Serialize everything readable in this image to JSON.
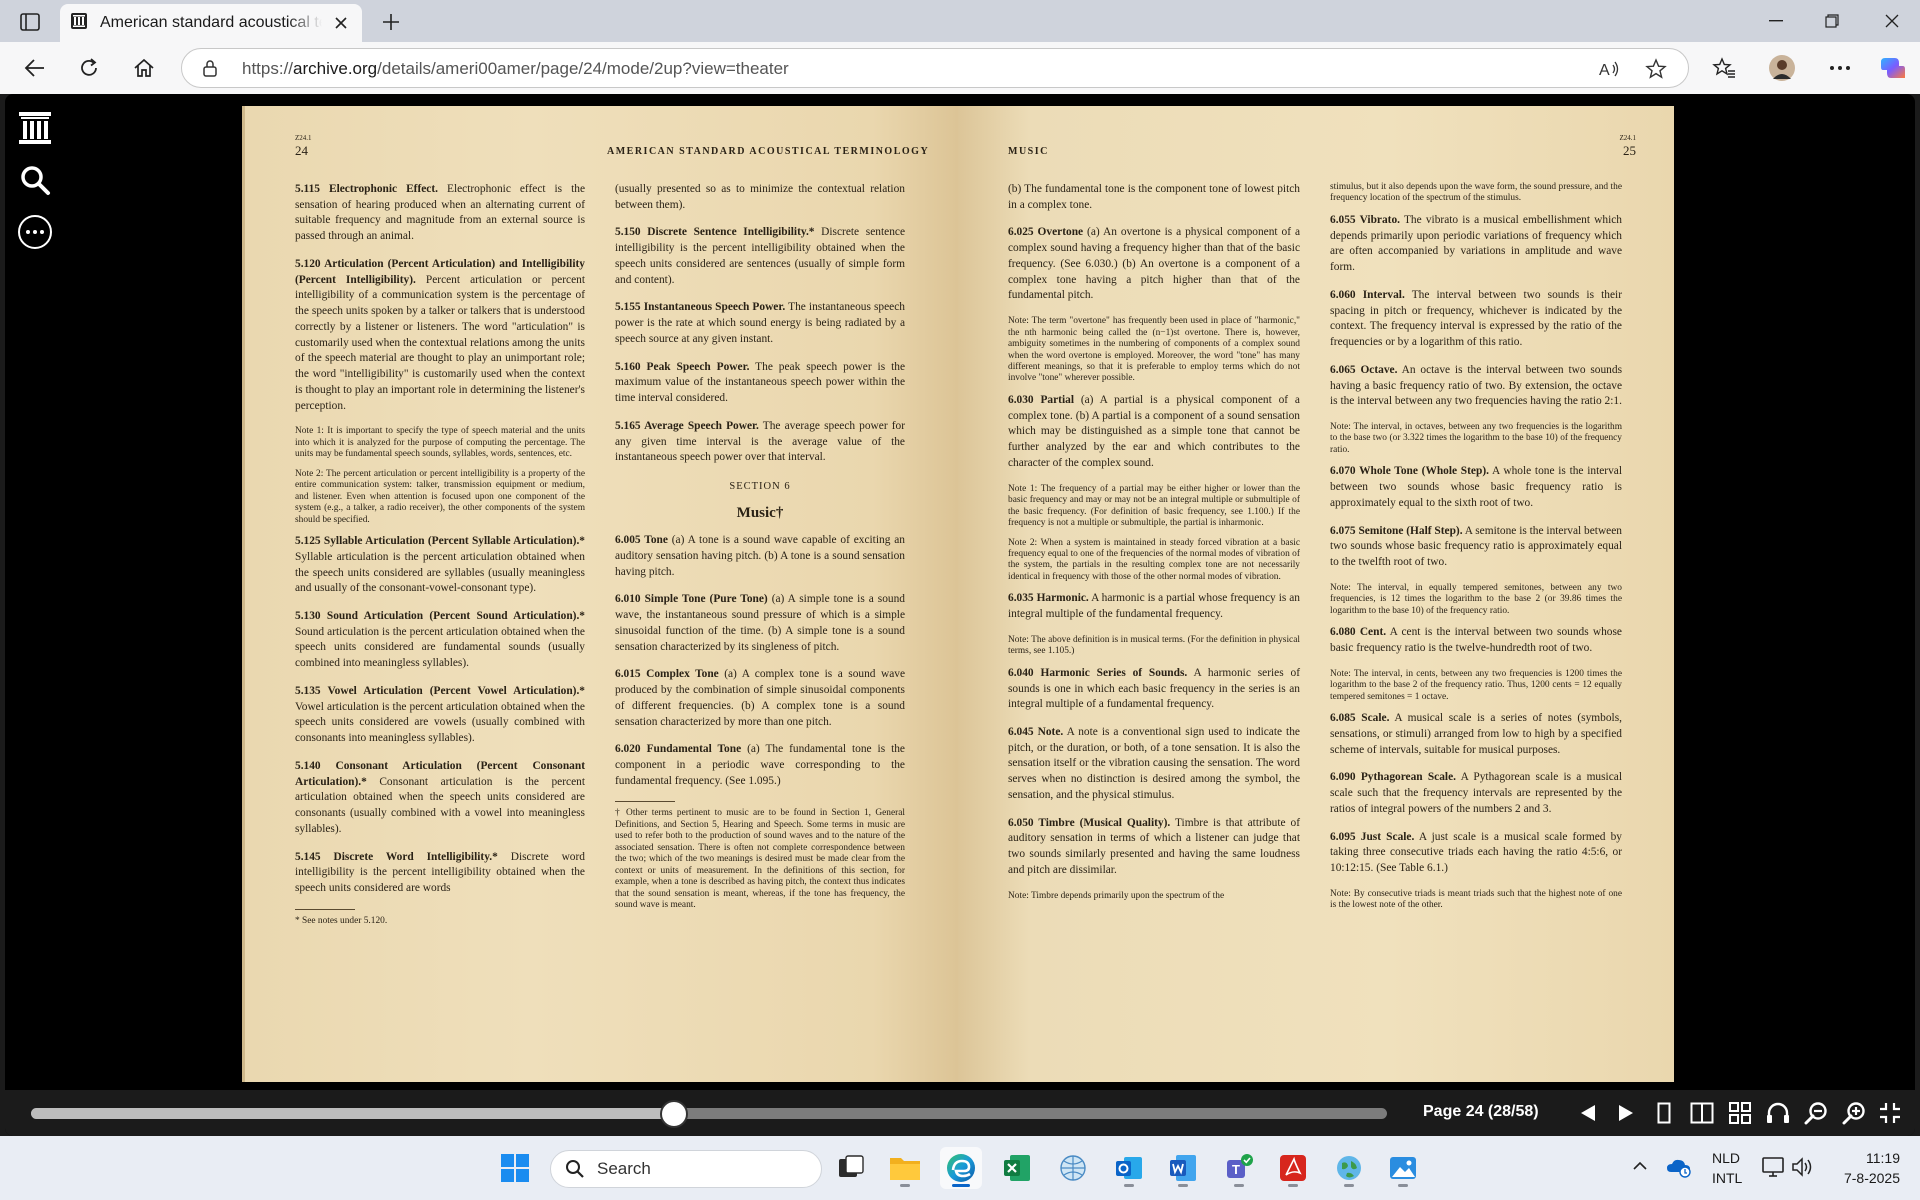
{
  "browser": {
    "tab_title": "American standard acoustical terminology",
    "url_prefix": "https://",
    "url_domain": "archive.org",
    "url_path": "/details/ameri00amer/page/24/mode/2up?view=theater"
  },
  "viewer": {
    "page_label": "Page 24 (28/58)",
    "progress_fraction": 0.474
  },
  "book": {
    "left_header": {
      "small": "Z24.1",
      "page_num": "24",
      "title": "AMERICAN STANDARD ACOUSTICAL TERMINOLOGY"
    },
    "right_header": {
      "small": "Z24.1",
      "page_num": "25",
      "title": "MUSIC"
    },
    "left_col1": [
      {
        "head": "5.115 Electrophonic Effect.",
        "body": " Electrophonic effect is the sensation of hearing produced when an alternating current of suitable frequency and magnitude from an external source is passed through an animal."
      },
      {
        "head": "5.120 Articulation (Percent Articulation) and Intelligibility (Percent Intelligibility).",
        "body": " Percent articulation or percent intelligibility of a communication system is the percentage of the speech units spoken by a talker or talkers that is understood correctly by a listener or listeners. The word \"articulation\" is customarily used when the contextual relations among the units of the speech material are thought to play an unimportant role; the word \"intelligibility\" is customarily used when the context is thought to play an important role in determining the listener's perception."
      },
      {
        "note": "Note 1: It is important to specify the type of speech material and the units into which it is analyzed for the purpose of computing the percentage. The units may be fundamental speech sounds, syllables, words, sentences, etc."
      },
      {
        "note": "Note 2: The percent articulation or percent intelligibility is a property of the entire communication system: talker, transmission equipment or medium, and listener. Even when attention is focused upon one component of the system (e.g., a talker, a radio receiver), the other components of the system should be specified."
      },
      {
        "head": "5.125 Syllable Articulation (Percent Syllable Articulation).*",
        "body": " Syllable articulation is the percent articulation obtained when the speech units considered are syllables (usually meaningless and usually of the consonant-vowel-consonant type)."
      },
      {
        "head": "5.130 Sound Articulation (Percent Sound Articulation).*",
        "body": " Sound articulation is the percent articulation obtained when the speech units considered are fundamental sounds (usually combined into meaningless syllables)."
      },
      {
        "head": "5.135 Vowel Articulation (Percent Vowel Articulation).*",
        "body": " Vowel articulation is the percent articulation obtained when the speech units considered are vowels (usually combined with consonants into meaningless syllables)."
      },
      {
        "head": "5.140 Consonant Articulation (Percent Consonant Articulation).*",
        "body": " Consonant articulation is the percent articulation obtained when the speech units considered are consonants (usually combined with a vowel into meaningless syllables)."
      },
      {
        "head": "5.145 Discrete Word Intelligibility.*",
        "body": " Discrete word intelligibility is the percent intelligibility obtained when the speech units considered are words"
      },
      {
        "note": "* See notes under 5.120."
      }
    ],
    "left_col2": [
      {
        "body": "(usually presented so as to minimize the contextual relation between them)."
      },
      {
        "head": "5.150 Discrete Sentence Intelligibility.*",
        "body": " Discrete sentence intelligibility is the percent intelligibility obtained when the speech units considered are sentences (usually of simple form and content)."
      },
      {
        "head": "5.155 Instantaneous Speech Power.",
        "body": " The instantaneous speech power is the rate at which sound energy is being radiated by a speech source at any given instant."
      },
      {
        "head": "5.160 Peak Speech Power.",
        "body": " The peak speech power is the maximum value of the instantaneous speech power within the time interval considered."
      },
      {
        "head": "5.165 Average Speech Power.",
        "body": " The average speech power for any given time interval is the average value of the instantaneous speech power over that interval."
      },
      {
        "section": "SECTION 6",
        "section_title": "Music†"
      },
      {
        "head": "6.005 Tone",
        "body": " (a) A tone is a sound wave capable of exciting an auditory sensation having pitch. (b) A tone is a sound sensation having pitch."
      },
      {
        "head": "6.010 Simple Tone (Pure Tone)",
        "body": " (a) A simple tone is a sound wave, the instantaneous sound pressure of which is a simple sinusoidal function of the time. (b) A simple tone is a sound sensation characterized by its singleness of pitch."
      },
      {
        "head": "6.015 Complex Tone",
        "body": " (a) A complex tone is a sound wave produced by the combination of simple sinusoidal components of different frequencies. (b) A complex tone is a sound sensation characterized by more than one pitch."
      },
      {
        "head": "6.020 Fundamental Tone",
        "body": " (a) The fundamental tone is the component in a periodic wave corresponding to the fundamental frequency. (See 1.095.)"
      },
      {
        "note": "† Other terms pertinent to music are to be found in Section 1, General Definitions, and Section 5, Hearing and Speech. Some terms in music are used to refer both to the production of sound waves and to the nature of the associated sensation. There is often not complete correspondence between the two; which of the two meanings is desired must be made clear from the context or units of measurement. In the definitions of this section, for example, when a tone is described as having pitch, the context thus indicates that the sound sensation is meant, whereas, if the tone has frequency, the sound wave is meant."
      }
    ],
    "right_col1": [
      {
        "body": "(b) The fundamental tone is the component tone of lowest pitch in a complex tone."
      },
      {
        "head": "6.025 Overtone",
        "body": " (a) An overtone is a physical component of a complex sound having a frequency higher than that of the basic frequency. (See 6.030.) (b) An overtone is a component of a complex tone having a pitch higher than that of the fundamental pitch."
      },
      {
        "note": "Note: The term \"overtone\" has frequently been used in place of \"harmonic,\" the nth harmonic being called the (n−1)st overtone. There is, however, ambiguity sometimes in the numbering of components of a complex sound when the word overtone is employed. Moreover, the word \"tone\" has many different meanings, so that it is preferable to employ terms which do not involve \"tone\" wherever possible."
      },
      {
        "head": "6.030 Partial",
        "body": " (a) A partial is a physical component of a complex tone. (b) A partial is a component of a sound sensation which may be distinguished as a simple tone that cannot be further analyzed by the ear and which contributes to the character of the complex sound."
      },
      {
        "note": "Note 1: The frequency of a partial may be either higher or lower than the basic frequency and may or may not be an integral multiple or submultiple of the basic frequency. (For definition of basic frequency, see 1.100.) If the frequency is not a multiple or submultiple, the partial is inharmonic."
      },
      {
        "note": "Note 2: When a system is maintained in steady forced vibration at a basic frequency equal to one of the frequencies of the normal modes of vibration of the system, the partials in the resulting complex tone are not necessarily identical in frequency with those of the other normal modes of vibration."
      },
      {
        "head": "6.035 Harmonic.",
        "body": " A harmonic is a partial whose frequency is an integral multiple of the fundamental frequency."
      },
      {
        "note": "Note: The above definition is in musical terms. (For the definition in physical terms, see 1.105.)"
      },
      {
        "head": "6.040 Harmonic Series of Sounds.",
        "body": " A harmonic series of sounds is one in which each basic frequency in the series is an integral multiple of a fundamental frequency."
      },
      {
        "head": "6.045 Note.",
        "body": " A note is a conventional sign used to indicate the pitch, or the duration, or both, of a tone sensation. It is also the sensation itself or the vibration causing the sensation. The word serves when no distinction is desired among the symbol, the sensation, and the physical stimulus."
      },
      {
        "head": "6.050 Timbre (Musical Quality).",
        "body": " Timbre is that attribute of auditory sensation in terms of which a listener can judge that two sounds similarly presented and having the same loudness and pitch are dissimilar."
      },
      {
        "note": "Note: Timbre depends primarily upon the spectrum of the"
      }
    ],
    "right_col2": [
      {
        "note": "stimulus, but it also depends upon the wave form, the sound pressure, and the frequency location of the spectrum of the stimulus."
      },
      {
        "head": "6.055 Vibrato.",
        "body": " The vibrato is a musical embellishment which depends primarily upon periodic variations of frequency which are often accompanied by variations in amplitude and wave form."
      },
      {
        "head": "6.060 Interval.",
        "body": " The interval between two sounds is their spacing in pitch or frequency, whichever is indicated by the context. The frequency interval is expressed by the ratio of the frequencies or by a logarithm of this ratio."
      },
      {
        "head": "6.065 Octave.",
        "body": " An octave is the interval between two sounds having a basic frequency ratio of two. By extension, the octave is the interval between any two frequencies having the ratio 2:1."
      },
      {
        "note": "Note: The interval, in octaves, between any two frequencies is the logarithm to the base two (or 3.322 times the logarithm to the base 10) of the frequency ratio."
      },
      {
        "head": "6.070 Whole Tone (Whole Step).",
        "body": " A whole tone is the interval between two sounds whose basic frequency ratio is approximately equal to the sixth root of two."
      },
      {
        "head": "6.075 Semitone (Half Step).",
        "body": " A semitone is the interval between two sounds whose basic frequency ratio is approximately equal to the twelfth root of two."
      },
      {
        "note": "Note: The interval, in equally tempered semitones, between any two frequencies, is 12 times the logarithm to the base 2 (or 39.86 times the logarithm to the base 10) of the frequency ratio."
      },
      {
        "head": "6.080 Cent.",
        "body": " A cent is the interval between two sounds whose basic frequency ratio is the twelve-hundredth root of two."
      },
      {
        "note": "Note: The interval, in cents, between any two frequencies is 1200 times the logarithm to the base 2 of the frequency ratio. Thus, 1200 cents = 12 equally tempered semitones = 1 octave."
      },
      {
        "head": "6.085 Scale.",
        "body": " A musical scale is a series of notes (symbols, sensations, or stimuli) arranged from low to high by a specified scheme of intervals, suitable for musical purposes."
      },
      {
        "head": "6.090 Pythagorean Scale.",
        "body": " A Pythagorean scale is a musical scale such that the frequency intervals are represented by the ratios of integral powers of the numbers 2 and 3."
      },
      {
        "head": "6.095 Just Scale.",
        "body": " A just scale is a musical scale formed by taking three consecutive triads each having the ratio 4:5:6, or 10:12:15. (See Table 6.1.)"
      },
      {
        "note": "Note: By consecutive triads is meant triads such that the highest note of one is the lowest note of the other."
      }
    ]
  },
  "taskbar": {
    "search_placeholder": "Search",
    "lang_line1": "NLD",
    "lang_line2": "INTL",
    "time": "11:19",
    "date": "7-8-2025"
  },
  "colors": {
    "accent": "#0a64c8",
    "page": "#ecdcb7",
    "viewer_bg": "#000000"
  }
}
